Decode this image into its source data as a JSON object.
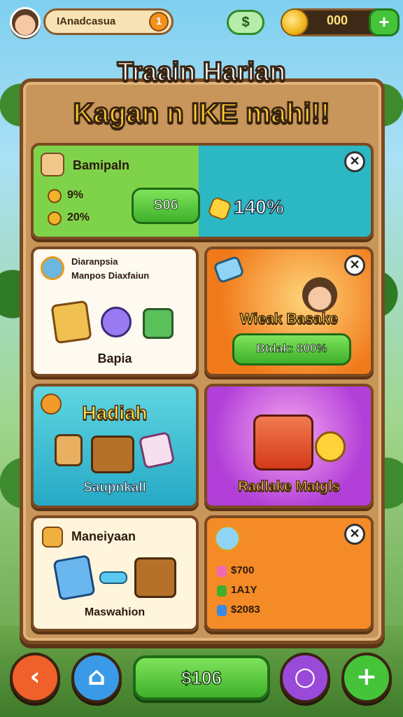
{
  "header": {
    "player_name": "IAnadcasua",
    "level": "1",
    "dollar_label": "$",
    "coins": "000",
    "plus_label": "+"
  },
  "title": {
    "line1": "Traain Harian",
    "line2": "Kagan n IKE mahi!!"
  },
  "cards": {
    "card1": {
      "title": "Bamipaln",
      "stat1": "9%",
      "stat2": "20%",
      "button": "S06",
      "reward": "140%",
      "close": "✕"
    },
    "card2": {
      "line1": "Diaranpsia",
      "line2": "Manpos Diaxfaiun",
      "label": "Bapia"
    },
    "card3": {
      "label": "Wieak Basake",
      "button": "Btdak: 800%",
      "close": "✕"
    },
    "card4": {
      "title": "Hadiah",
      "label": "Saupnkall"
    },
    "card5": {
      "label": "Radlake Matgls"
    },
    "card6": {
      "title": "Maneiyaan",
      "label": "Maswahion"
    },
    "card7": {
      "row1": "$700",
      "row2": "1A1Y",
      "row3": "$2083",
      "close": "✕"
    }
  },
  "nav": {
    "back": "‹",
    "home": "⌂",
    "price": "$106",
    "search": "○",
    "add": "+"
  },
  "colors": {
    "accent_green": "#45c43a",
    "wood": "#c8955a",
    "title_yellow": "#ffcf2e"
  }
}
